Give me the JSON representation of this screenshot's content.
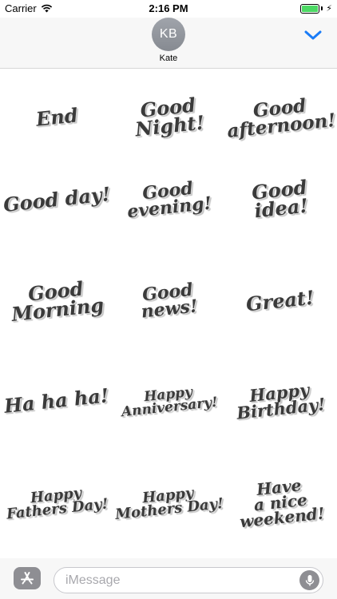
{
  "status_bar": {
    "carrier": "Carrier",
    "time": "2:16 PM",
    "battery_level": 1.0,
    "charging": true,
    "bolt_glyph": "⚡"
  },
  "header": {
    "avatar_initials": "KB",
    "contact_name": "Kate",
    "accent_color": "#1a7cf7"
  },
  "stickers": [
    {
      "text": "End",
      "icon": "sticker-end"
    },
    {
      "text": "Good\nNight!",
      "icon": "sticker-good-night"
    },
    {
      "text": "Good\nafternoon!",
      "icon": "sticker-good-afternoon"
    },
    {
      "text": "Good day!",
      "icon": "sticker-good-day"
    },
    {
      "text": "Good\nevening!",
      "icon": "sticker-good-evening"
    },
    {
      "text": "Good idea!",
      "icon": "sticker-good-idea"
    },
    {
      "text": "Good\nMorning",
      "icon": "sticker-good-morning"
    },
    {
      "text": "Good news!",
      "icon": "sticker-good-news"
    },
    {
      "text": "Great!",
      "icon": "sticker-great"
    },
    {
      "text": "Ha ha ha!",
      "icon": "sticker-ha-ha-ha"
    },
    {
      "text": "Happy\nAnniversary!",
      "icon": "sticker-happy-anniversary"
    },
    {
      "text": "Happy\nBirthday!",
      "icon": "sticker-happy-birthday"
    },
    {
      "text": "Happy\nFathers Day!",
      "icon": "sticker-happy-fathers-day"
    },
    {
      "text": "Happy\nMothers Day!",
      "icon": "sticker-happy-mothers-day"
    },
    {
      "text": "Have\na nice\nweekend!",
      "icon": "sticker-have-a-nice-weekend"
    }
  ],
  "input_bar": {
    "placeholder": "iMessage",
    "value": "",
    "app_store_icon": "app-store-icon",
    "mic_icon": "microphone-icon"
  }
}
